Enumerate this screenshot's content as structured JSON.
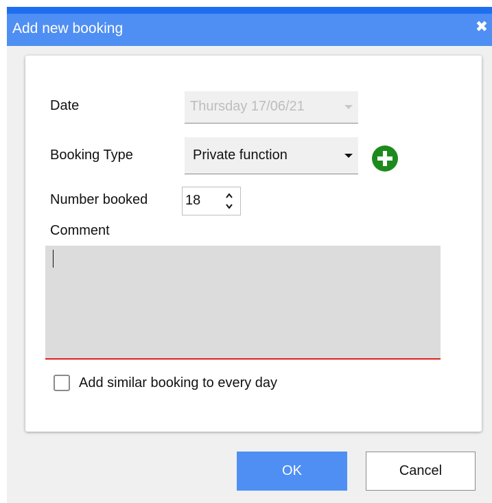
{
  "dialog": {
    "title": "Add new booking",
    "close_icon": "close-icon",
    "accent_color": "#4f8ff3"
  },
  "form": {
    "date_label": "Date",
    "date_value": "Thursday 17/06/21",
    "booking_type_label": "Booking Type",
    "booking_type_value": "Private function",
    "add_booking_type_icon": "plus-circle-icon",
    "number_booked_label": "Number booked",
    "number_booked_value": "18",
    "comment_label": "Comment",
    "comment_value": "",
    "add_similar_label": "Add similar booking to every day",
    "add_similar_checked": false
  },
  "buttons": {
    "ok_label": "OK",
    "cancel_label": "Cancel"
  }
}
